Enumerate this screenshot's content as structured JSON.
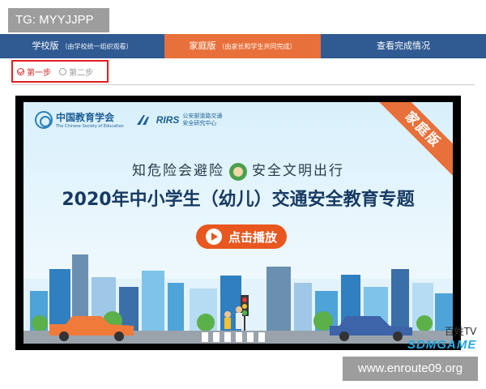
{
  "overlay": {
    "tg_label": "TG: MYYJJPP",
    "url_label": "www.enroute09.org",
    "watermark_line1": "百姓TV",
    "watermark_line2": "SDMGAME"
  },
  "tabs": [
    {
      "label": "学校版",
      "sub": "（由学校统一组织观看）",
      "active": false
    },
    {
      "label": "家庭版",
      "sub": "（由家长和学生共同完成）",
      "active": true
    },
    {
      "label": "查看完成情况",
      "sub": "",
      "active": false
    }
  ],
  "steps": [
    {
      "label": "第一步",
      "active": true
    },
    {
      "label": "第二步",
      "active": false
    }
  ],
  "video": {
    "logo1_cn": "中国教育学会",
    "logo1_en": "The Chinese Society of Education",
    "logo2_brand": "RIRS",
    "logo2_org_line1": "公安部道路交通",
    "logo2_org_line2": "安全研究中心",
    "ribbon": "家庭版",
    "slogan_left": "知危险会避险",
    "slogan_right": "安全文明出行",
    "title": "2020年中小学生（幼儿）交通安全教育专题",
    "play_label": "点击播放"
  },
  "colors": {
    "tab_bar": "#2f5a92",
    "tab_active": "#e8703a",
    "step_active": "#d62b2b",
    "play_button": "#e8571f",
    "title": "#173a63"
  }
}
